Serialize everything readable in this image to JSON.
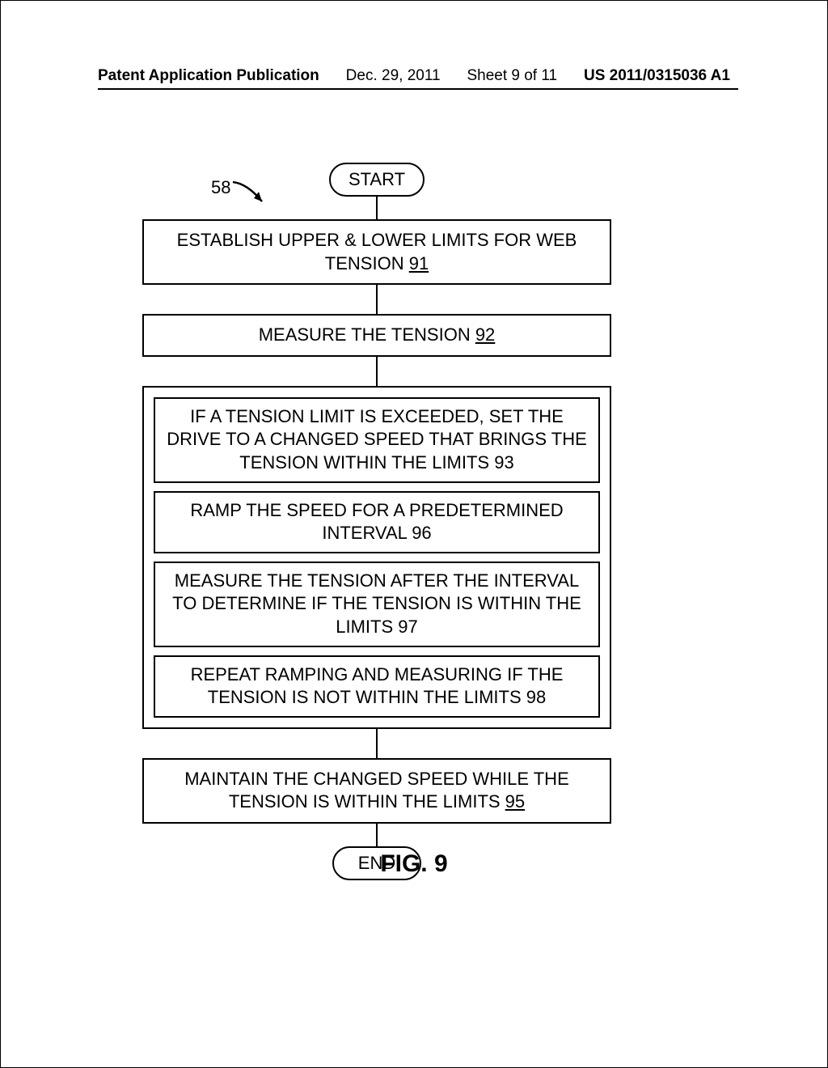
{
  "header": {
    "pub": "Patent Application Publication",
    "date": "Dec. 29, 2011",
    "sheet": "Sheet 9 of 11",
    "docnum": "US 2011/0315036 A1"
  },
  "callout": {
    "ref58": "58"
  },
  "flow": {
    "start": "START",
    "end": "END",
    "step91": {
      "text": "ESTABLISH UPPER & LOWER LIMITS FOR WEB TENSION ",
      "ref": "91"
    },
    "step92": {
      "text": "MEASURE THE TENSION ",
      "ref": "92"
    },
    "step93": {
      "text": "IF A TENSION LIMIT IS EXCEEDED, SET THE DRIVE TO A CHANGED SPEED THAT BRINGS THE TENSION WITHIN THE LIMITS ",
      "ref": "93"
    },
    "step96": {
      "text": "RAMP THE SPEED FOR A PREDETERMINED INTERVAL ",
      "ref": "96"
    },
    "step97": {
      "text": "MEASURE THE TENSION AFTER THE INTERVAL TO DETERMINE IF THE TENSION IS WITHIN THE LIMITS ",
      "ref": "97"
    },
    "step98": {
      "text": "REPEAT RAMPING AND MEASURING IF THE TENSION IS NOT WITHIN THE LIMITS ",
      "ref": "98"
    },
    "step95": {
      "text": "MAINTAIN THE CHANGED SPEED WHILE THE TENSION IS WITHIN THE LIMITS ",
      "ref": "95"
    }
  },
  "figure": {
    "label": "FIG. 9"
  }
}
